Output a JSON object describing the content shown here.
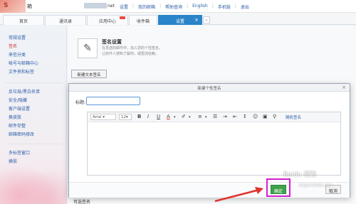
{
  "topbar": {
    "brand_text": "箱",
    "account_suffix": "net",
    "links": [
      "设置",
      "我的邮箱",
      "帮助查询",
      "English",
      "手机版",
      "退出"
    ]
  },
  "tabs": [
    {
      "label": "首页"
    },
    {
      "label": "通讯录"
    },
    {
      "label": "应用中心"
    },
    {
      "label": "收件箱"
    },
    {
      "label": "设置"
    }
  ],
  "sidebar": {
    "group1": [
      "常规设置",
      "签名",
      "来信分类",
      "帐号与邮箱中心",
      "文件夹和标签"
    ],
    "group2": [
      "反垃圾/黑白名单",
      "安全/隐藏",
      "客户端设置",
      "换皮肤",
      "邮件存整",
      "邮箱密码修改"
    ],
    "group3": [
      "多标签窗口",
      "换肤"
    ]
  },
  "main": {
    "sig_title": "签名设置",
    "sig_desc_line1": "在发送的邮件中，加入您的个性签名，",
    "sig_desc_line2": "让收件人感知了解你，或更加信赖。",
    "new_button": "新建文本签名",
    "available_label": "可选签名"
  },
  "dialog": {
    "title": "新建个性签名",
    "label_title": "标题:",
    "font_name": "Arial",
    "font_size": "12",
    "toolbar_link": "随机签名",
    "ok_button": "确定",
    "cancel_button": "取消"
  },
  "watermark": {
    "text": "Baidu 经验",
    "url": "jingyan.baidu.com"
  },
  "colors": {
    "accent": "#2a84c7",
    "ok_green": "#3ea14b",
    "highlight": "#d21fd2",
    "arrow": "#e0332f"
  }
}
